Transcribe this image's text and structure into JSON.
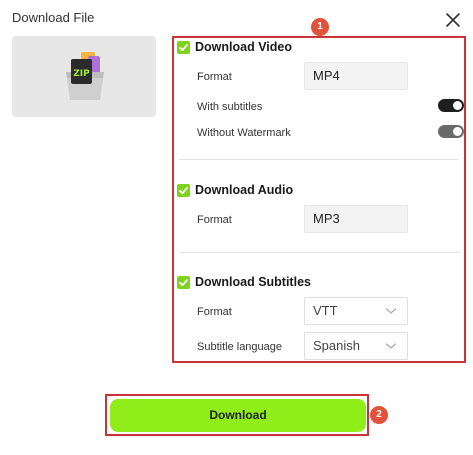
{
  "dialog": {
    "title": "Download File"
  },
  "video": {
    "title": "Download Video",
    "format_label": "Format",
    "format_value": "MP4",
    "subtitles_label": "With subtitles",
    "watermark_label": "Without Watermark"
  },
  "audio": {
    "title": "Download Audio",
    "format_label": "Format",
    "format_value": "MP3"
  },
  "subtitles": {
    "title": "Download Subtitles",
    "format_label": "Format",
    "format_value": "VTT",
    "language_label": "Subtitle language",
    "language_value": "Spanish"
  },
  "badges": {
    "one": "1",
    "two": "2"
  },
  "thumbnail": {
    "icon_text": "ZIP"
  },
  "download_button": {
    "label": "Download"
  },
  "colors": {
    "accent": "#90ed1a",
    "checkbox": "#7ed31d",
    "highlight": "#c9343a",
    "badge": "#e0533a"
  },
  "icons": {
    "close": "close-icon",
    "check": "check-icon",
    "chevron": "chevron-down-icon",
    "archive": "zip-archive-icon"
  }
}
